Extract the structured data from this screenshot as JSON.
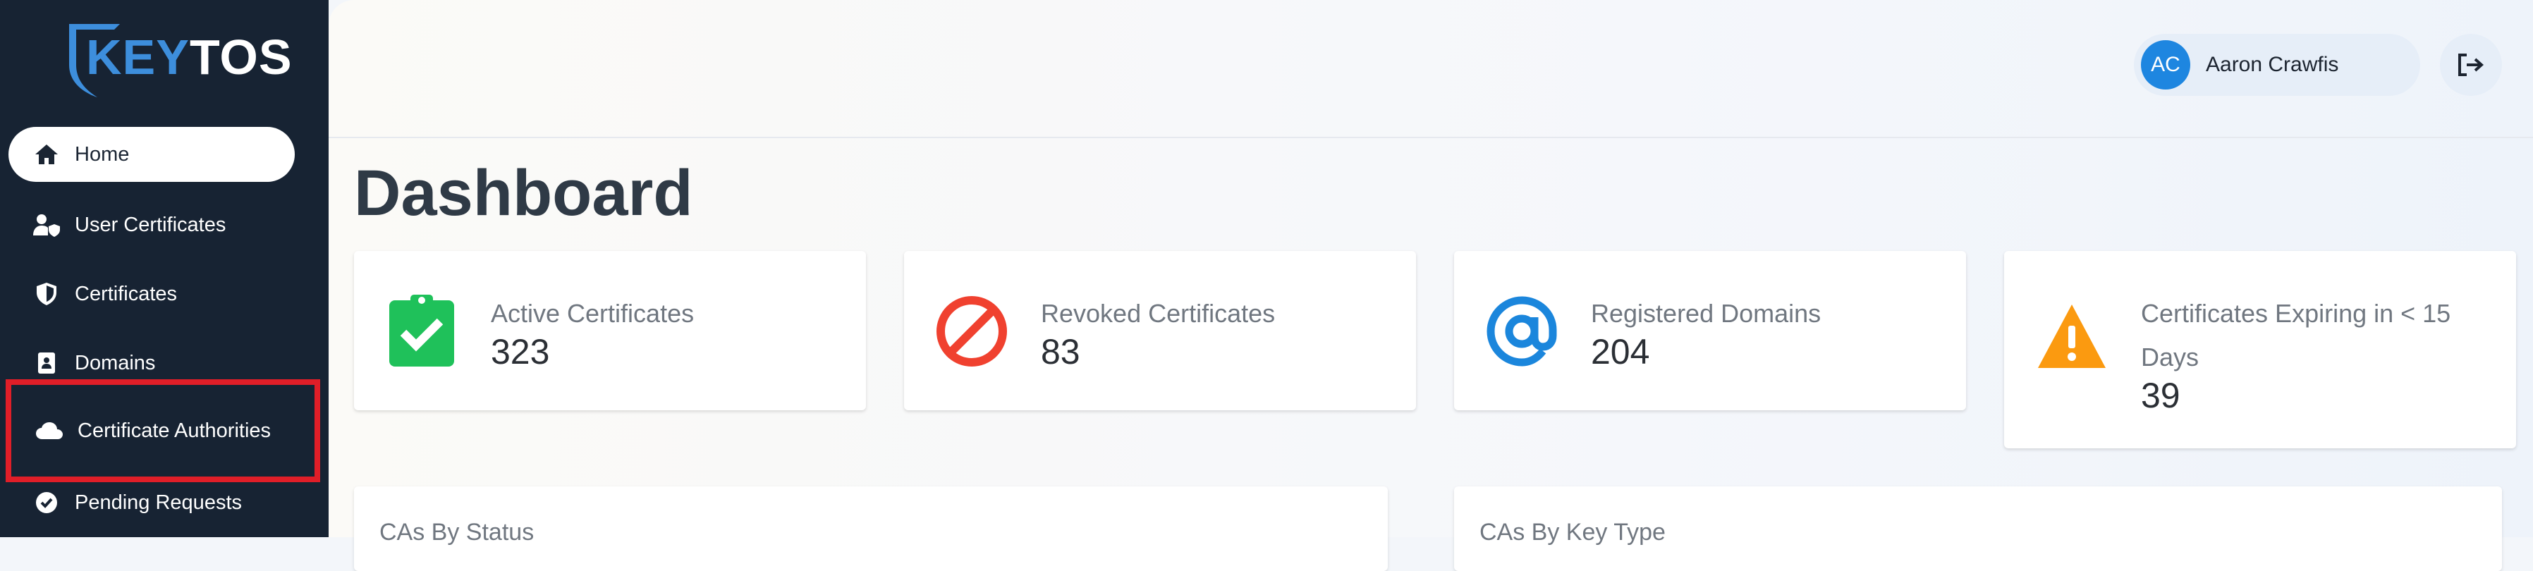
{
  "brand": {
    "logo_part1": "KEY",
    "logo_part2": "TOS"
  },
  "sidebar": {
    "items": [
      {
        "label": "Home",
        "icon": "home-icon",
        "active": true
      },
      {
        "label": "User Certificates",
        "icon": "user-shield-icon"
      },
      {
        "label": "Certificates",
        "icon": "shield-icon"
      },
      {
        "label": "Domains",
        "icon": "address-book-icon"
      },
      {
        "label": "Certificate Authorities",
        "icon": "cloud-icon",
        "highlighted": true
      },
      {
        "label": "Pending Requests",
        "icon": "check-circle-icon"
      }
    ]
  },
  "header": {
    "user": {
      "initials": "AC",
      "name": "Aaron Crawfis"
    },
    "logout_icon": "logout-icon"
  },
  "page": {
    "title": "Dashboard"
  },
  "stats": [
    {
      "label": "Active Certificates",
      "value": "323",
      "icon": "clipboard-check-icon",
      "color": "#1fc15a"
    },
    {
      "label": "Revoked Certificates",
      "value": "83",
      "icon": "ban-icon",
      "color": "#f0412f"
    },
    {
      "label": "Registered Domains",
      "value": "204",
      "icon": "at-icon",
      "color": "#1b86dc"
    },
    {
      "label": "Certificates Expiring in < 15 Days",
      "value": "39",
      "icon": "warning-icon",
      "color": "#fb9a10"
    }
  ],
  "panels": [
    {
      "title": "CAs By Status"
    },
    {
      "title": "CAs By Key Type"
    }
  ],
  "colors": {
    "sidebar_bg": "#172333",
    "accent": "#1e86e0",
    "highlight": "#e01e28"
  }
}
